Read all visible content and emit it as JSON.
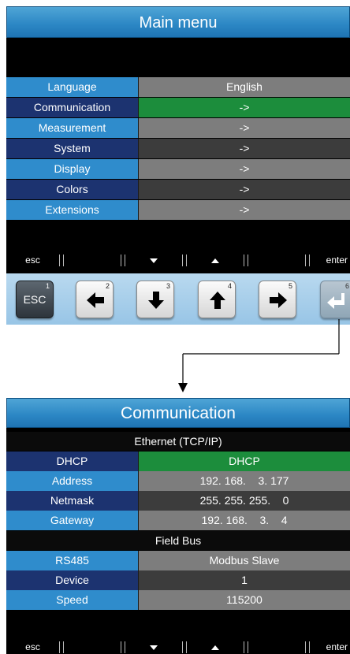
{
  "main_menu": {
    "title": "Main menu",
    "rows": [
      {
        "label": "Language",
        "value": "English"
      },
      {
        "label": "Communication",
        "value": "->"
      },
      {
        "label": "Measurement",
        "value": "->"
      },
      {
        "label": "System",
        "value": "->"
      },
      {
        "label": "Display",
        "value": "->"
      },
      {
        "label": "Colors",
        "value": "->"
      },
      {
        "label": "Extensions",
        "value": "->"
      }
    ]
  },
  "softkeys": {
    "esc": "esc",
    "enter": "enter",
    "down_icon": "down-triangle-icon",
    "up_icon": "up-triangle-icon"
  },
  "hardware_keys": [
    {
      "number": "1",
      "label": "ESC",
      "icon": "esc"
    },
    {
      "number": "2",
      "icon": "arrow-left-icon"
    },
    {
      "number": "3",
      "icon": "arrow-down-icon"
    },
    {
      "number": "4",
      "icon": "arrow-up-icon"
    },
    {
      "number": "5",
      "icon": "arrow-right-icon"
    },
    {
      "number": "6",
      "icon": "enter-return-icon"
    }
  ],
  "communication": {
    "title": "Communication",
    "ethernet_header": "Ethernet (TCP/IP)",
    "ethernet_rows": [
      {
        "label": "DHCP",
        "value": "DHCP"
      },
      {
        "label": "Address",
        "value": "192. 168.    3. 177"
      },
      {
        "label": "Netmask",
        "value": "255. 255. 255.    0"
      },
      {
        "label": "Gateway",
        "value": "192. 168.    3.    4"
      }
    ],
    "fieldbus_header": "Field Bus",
    "fieldbus_rows": [
      {
        "label": "RS485",
        "value": "Modbus Slave"
      },
      {
        "label": "Device",
        "value": "1"
      },
      {
        "label": "Speed",
        "value": "115200"
      }
    ]
  },
  "colors": {
    "title_bar": "#2b86c4",
    "label_light": "#2f8ccc",
    "label_dark": "#1c3370",
    "value_gray": "#7d7d7d",
    "value_dark": "#3c3c3c",
    "value_selected": "#1c8d3c",
    "keypad_bg": "#b9d9ef"
  }
}
